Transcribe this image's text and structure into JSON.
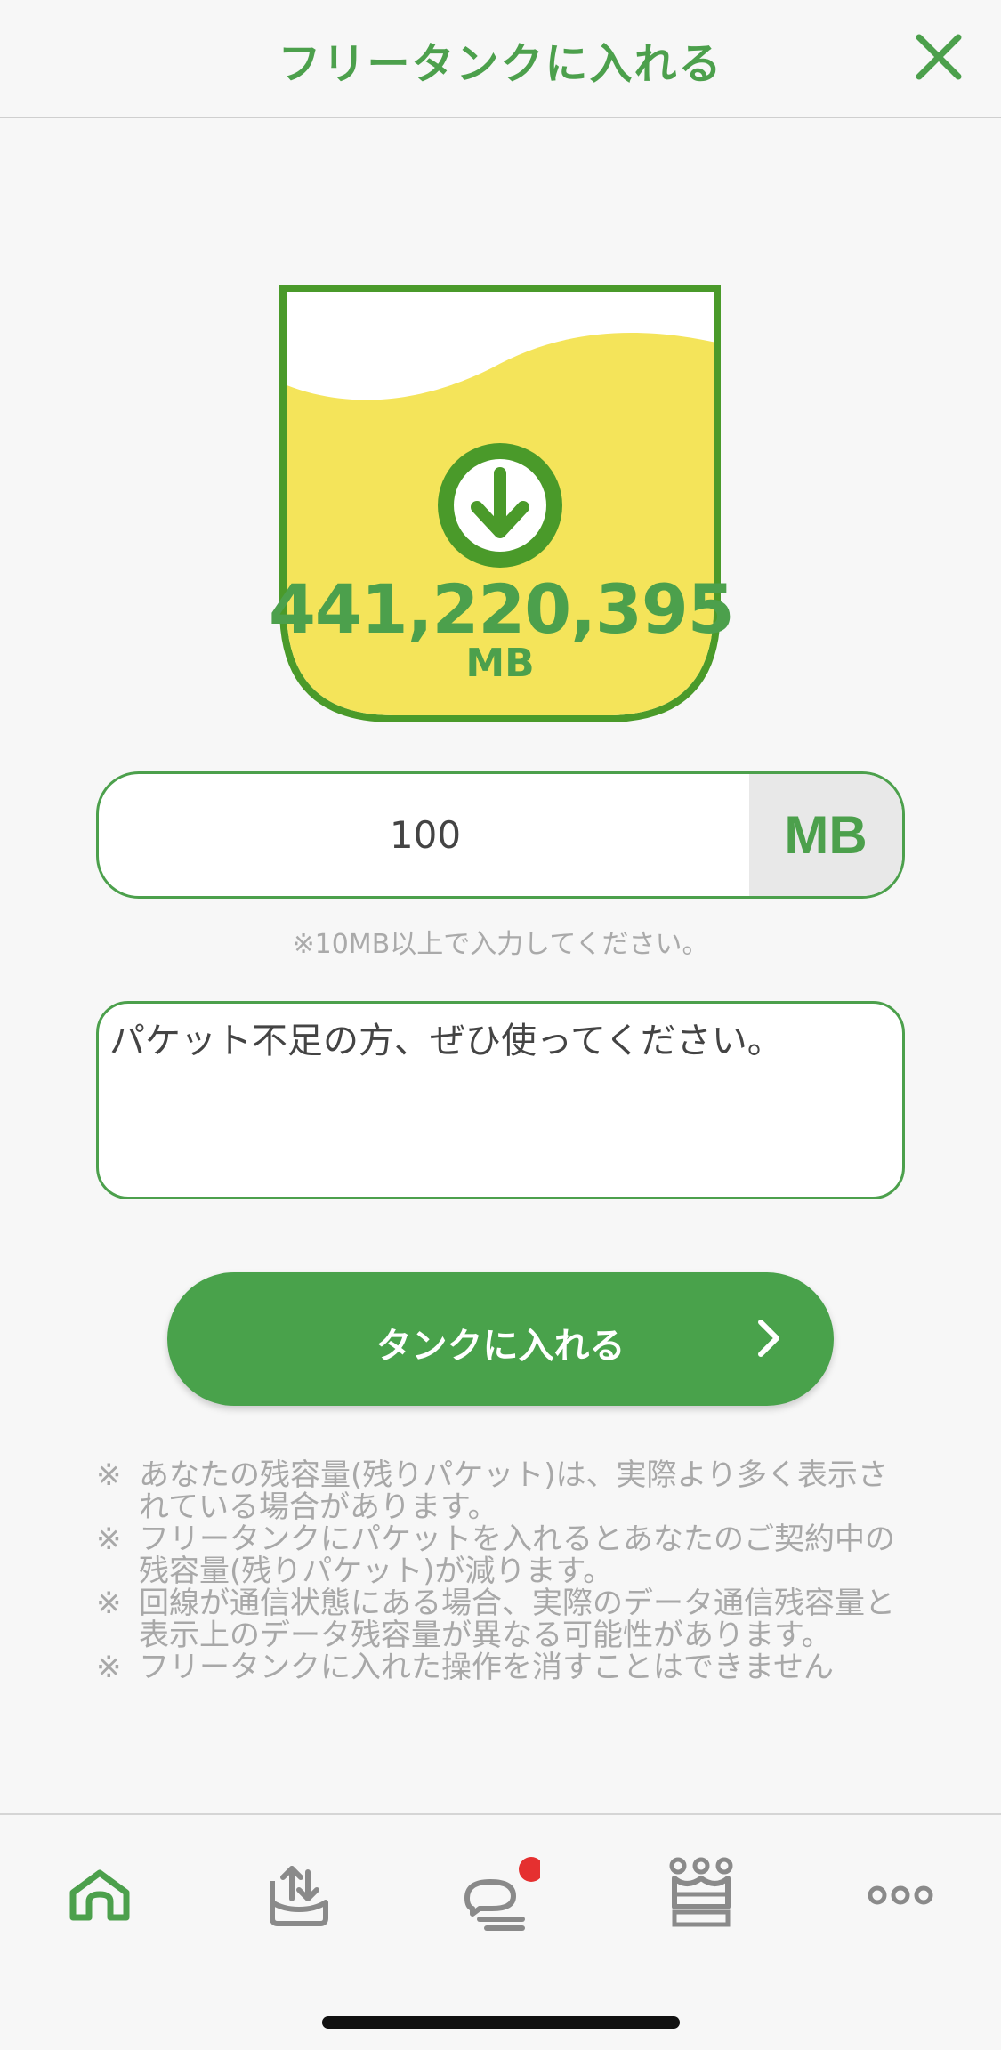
{
  "header": {
    "title": "フリータンクに入れる",
    "close_icon": "close-icon"
  },
  "tank": {
    "amount": "441,220,395",
    "unit": "MB",
    "icon": "download-arrow-icon",
    "colors": {
      "frame": "#4a9a2a",
      "fill": "#f4e45a",
      "accent": "#4ca04c"
    }
  },
  "amount_field": {
    "value": "100",
    "unit": "MB",
    "hint": "※10MB以上で入力してください。"
  },
  "message_field": {
    "value": "パケット不足の方、ぜひ使ってください。"
  },
  "submit": {
    "label": "タンクに入れる",
    "icon": "chevron-right-icon"
  },
  "notes": [
    {
      "mark": "※",
      "text": "あなたの残容量(残りパケット)は、実際より多く表示されている場合があります。"
    },
    {
      "mark": "※",
      "text": "フリータンクにパケットを入れるとあなたのご契約中の残容量(残りパケット)が減ります。"
    },
    {
      "mark": "※",
      "text": "回線が通信状態にある場合、実際のデータ通信残容量と表示上のデータ残容量が異なる可能性があります。"
    },
    {
      "mark": "※",
      "text": "フリータンクに入れた操作を消すことはできません"
    }
  ],
  "tabbar": {
    "items": [
      {
        "icon": "home-icon",
        "active": true
      },
      {
        "icon": "upload-tray-icon",
        "active": false
      },
      {
        "icon": "chat-bubble-icon",
        "active": false,
        "badge": true
      },
      {
        "icon": "crown-icon",
        "active": false
      },
      {
        "icon": "more-dots-icon",
        "active": false
      }
    ],
    "active_color": "#4ca04c",
    "inactive_color": "#8a8a8a",
    "badge_color": "#e53030"
  }
}
